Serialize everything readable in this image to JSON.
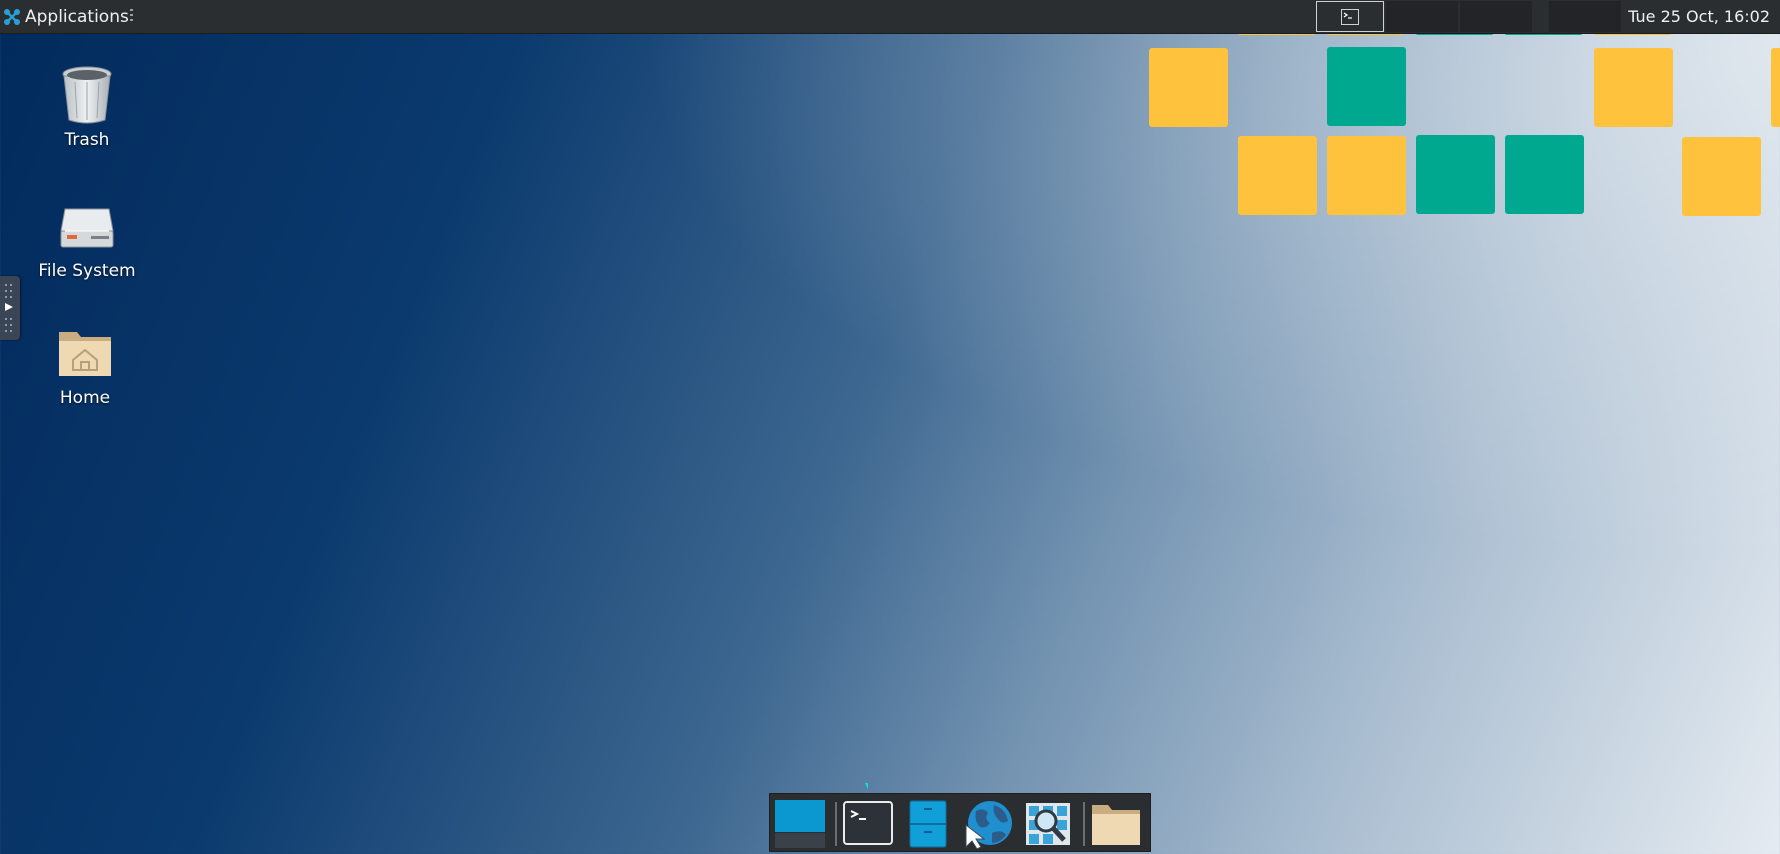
{
  "top_panel": {
    "applications_label": "Applications",
    "clock": "Tue 25 Oct, 16:02"
  },
  "desktop": {
    "icons": [
      {
        "label": "Trash",
        "icon": "trash-icon"
      },
      {
        "label": "File System",
        "icon": "drive-icon"
      },
      {
        "label": "Home",
        "icon": "home-folder-icon"
      }
    ]
  },
  "dock": {
    "items": [
      {
        "name": "show-desktop",
        "icon": "desktop-icon"
      },
      {
        "name": "terminal",
        "icon": "terminal-icon"
      },
      {
        "name": "file-manager",
        "icon": "file-cabinet-icon"
      },
      {
        "name": "web-browser",
        "icon": "globe-icon"
      },
      {
        "name": "app-finder",
        "icon": "magnifier-icon"
      },
      {
        "name": "folder",
        "icon": "folder-icon"
      }
    ]
  },
  "colors": {
    "panel": "#2b2e31",
    "tile_yellow": "#ffc23d",
    "tile_green": "#00a88f",
    "annotation_arrow": "#00e5e5"
  }
}
